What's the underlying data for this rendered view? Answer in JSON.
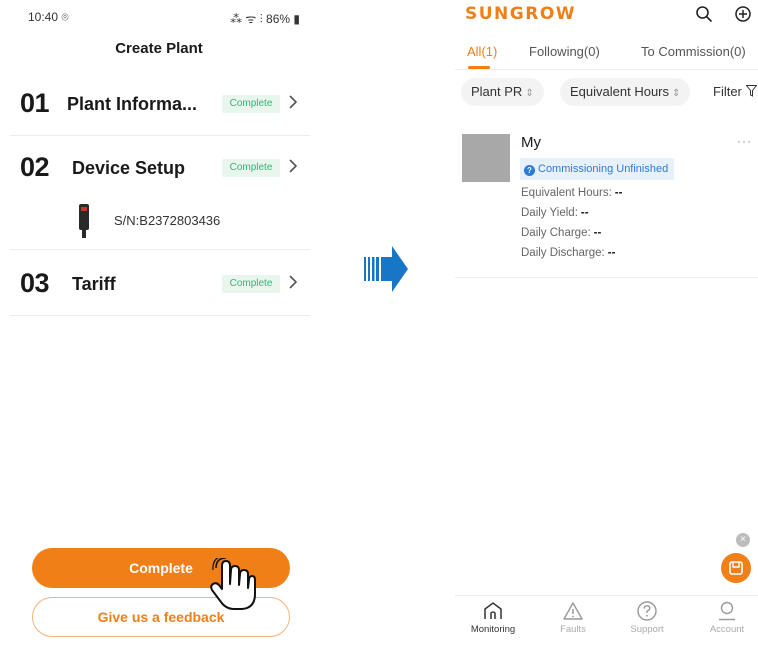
{
  "left": {
    "status_bar": {
      "time": "10:40 ⌾",
      "right": "⁂ ᯤ ⫶ 86% ▮"
    },
    "title": "Create Plant",
    "steps": [
      {
        "num": "01",
        "title": "Plant Informa...",
        "badge": "Complete"
      },
      {
        "num": "02",
        "title": "Device Setup",
        "badge": "Complete"
      },
      {
        "num": "03",
        "title": "Tariff",
        "badge": "Complete"
      }
    ],
    "device": {
      "sn": "S/N:B2372803436"
    },
    "complete_button": "Complete",
    "feedback_button": "Give us a feedback"
  },
  "right": {
    "logo": "SUNGROW",
    "tabs": [
      {
        "label": "All(1)"
      },
      {
        "label": "Following(0)"
      },
      {
        "label": "To Commission(0)"
      }
    ],
    "filters": {
      "chip1": "Plant PR",
      "chip2": "Equivalent Hours",
      "filter": "Filter"
    },
    "plant": {
      "name": "My",
      "more": "···",
      "status": "Commissioning Unfinished",
      "metrics": [
        {
          "label": "Equivalent Hours:",
          "value": "--"
        },
        {
          "label": "Daily Yield:",
          "value": "--"
        },
        {
          "label": "Daily Charge:",
          "value": "--"
        },
        {
          "label": "Daily Discharge:",
          "value": "--"
        }
      ]
    },
    "nav": [
      {
        "label": "Monitoring"
      },
      {
        "label": "Faults"
      },
      {
        "label": "Support"
      },
      {
        "label": "Account"
      }
    ]
  },
  "colors": {
    "accent": "#f07f17",
    "success": "#3bb273",
    "info": "#2d7bd6",
    "arrow": "#1976c7"
  }
}
